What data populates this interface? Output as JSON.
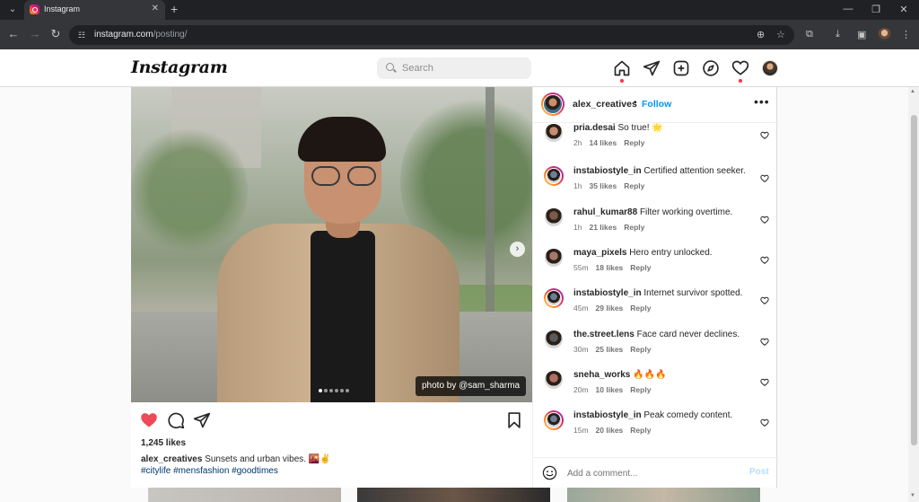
{
  "browser": {
    "tab_title": "Instagram",
    "url_host": "instagram.com",
    "url_path": "/posting/"
  },
  "header": {
    "logo": "Instagram",
    "search_placeholder": "Search"
  },
  "post": {
    "photo_credit": "photo by @sam_sharma",
    "carousel_dots": 6,
    "carousel_active": 1,
    "likes": "1,245 likes",
    "author": "alex_creatives",
    "caption": "Sunsets and urban vibes. 🌇✌️",
    "hashtags": "#citylife #mensfashion #goodtimes"
  },
  "panel": {
    "username": "alex_creatives",
    "separator": "•",
    "follow_label": "Follow",
    "more_label": "•••"
  },
  "comments": [
    {
      "user": "pria.desai",
      "text": "So true! 🌟",
      "time": "2h",
      "likes": "14 likes",
      "reply": "Reply",
      "avatar_color": "#c98b72",
      "ring": false
    },
    {
      "user": "instabiostyle_in",
      "text": "Certified attention seeker.",
      "time": "1h",
      "likes": "35 likes",
      "reply": "Reply",
      "avatar_color": "#6b7f99",
      "ring": true
    },
    {
      "user": "rahul_kumar88",
      "text": "Filter working overtime.",
      "time": "1h",
      "likes": "21 likes",
      "reply": "Reply",
      "avatar_color": "#7a5b48",
      "ring": false
    },
    {
      "user": "maya_pixels",
      "text": "Hero entry unlocked.",
      "time": "55m",
      "likes": "18 likes",
      "reply": "Reply",
      "avatar_color": "#a27a66",
      "ring": false
    },
    {
      "user": "instabiostyle_in",
      "text": "Internet survivor spotted.",
      "time": "45m",
      "likes": "29 likes",
      "reply": "Reply",
      "avatar_color": "#6b7f99",
      "ring": true
    },
    {
      "user": "the.street.lens",
      "text": "Face card never declines.",
      "time": "30m",
      "likes": "25 likes",
      "reply": "Reply",
      "avatar_color": "#5a5a5a",
      "ring": false
    },
    {
      "user": "sneha_works",
      "text": "🔥🔥🔥",
      "time": "20m",
      "likes": "10 likes",
      "reply": "Reply",
      "avatar_color": "#b06f62",
      "ring": false
    },
    {
      "user": "instabiostyle_in",
      "text": "Peak comedy content.",
      "time": "15m",
      "likes": "20 likes",
      "reply": "Reply",
      "avatar_color": "#6b7f99",
      "ring": true
    }
  ],
  "add_comment": {
    "placeholder": "Add a comment...",
    "post_label": "Post"
  },
  "colors": {
    "accent": "#0095f6",
    "like_red": "#ed4956",
    "notification": "#ff3040"
  }
}
